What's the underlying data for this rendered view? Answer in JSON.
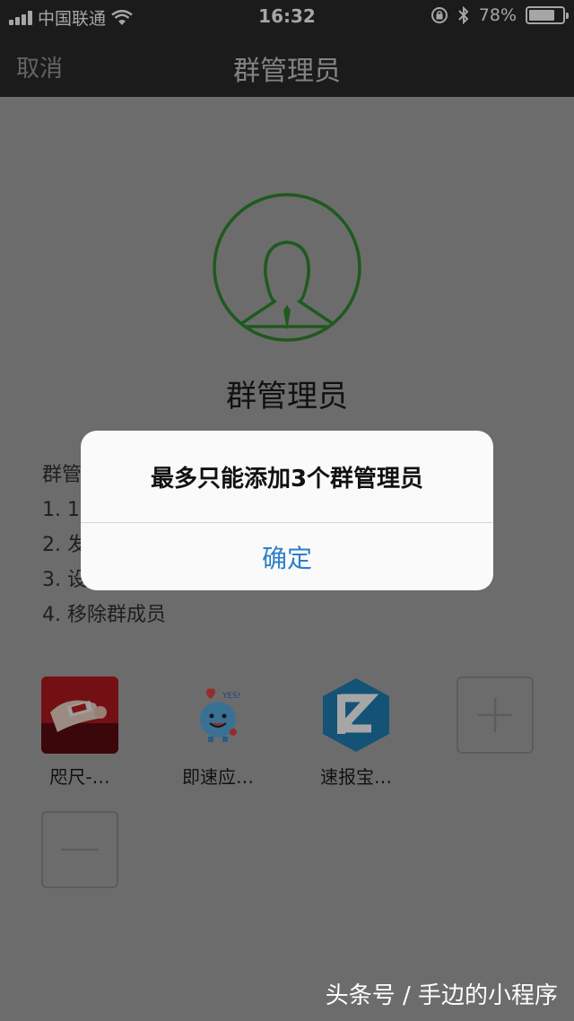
{
  "status_bar": {
    "carrier": "中国联通",
    "time": "16:32",
    "battery": "78%",
    "battery_level": 0.78
  },
  "nav": {
    "cancel_label": "取消",
    "title": "群管理员"
  },
  "content": {
    "title": "群管理员",
    "permissions": [
      "群管",
      "1. 10",
      "2. 发",
      "3. 设",
      "4. 移除群成员"
    ]
  },
  "members": [
    {
      "name": "咫尺-…",
      "icon": "photo-avatar"
    },
    {
      "name": "即速应…",
      "icon": "yes-mascot-avatar"
    },
    {
      "name": "速报宝…",
      "icon": "e-logo-avatar"
    }
  ],
  "buttons": {
    "add": "plus-icon",
    "remove": "minus-icon"
  },
  "alert": {
    "message": "最多只能添加3个群管理员",
    "confirm_label": "确定"
  },
  "watermark": "头条号 / 手边的小程序",
  "colors": {
    "accent_green": "#2e8b2e",
    "alert_button": "#2c7fc9"
  }
}
